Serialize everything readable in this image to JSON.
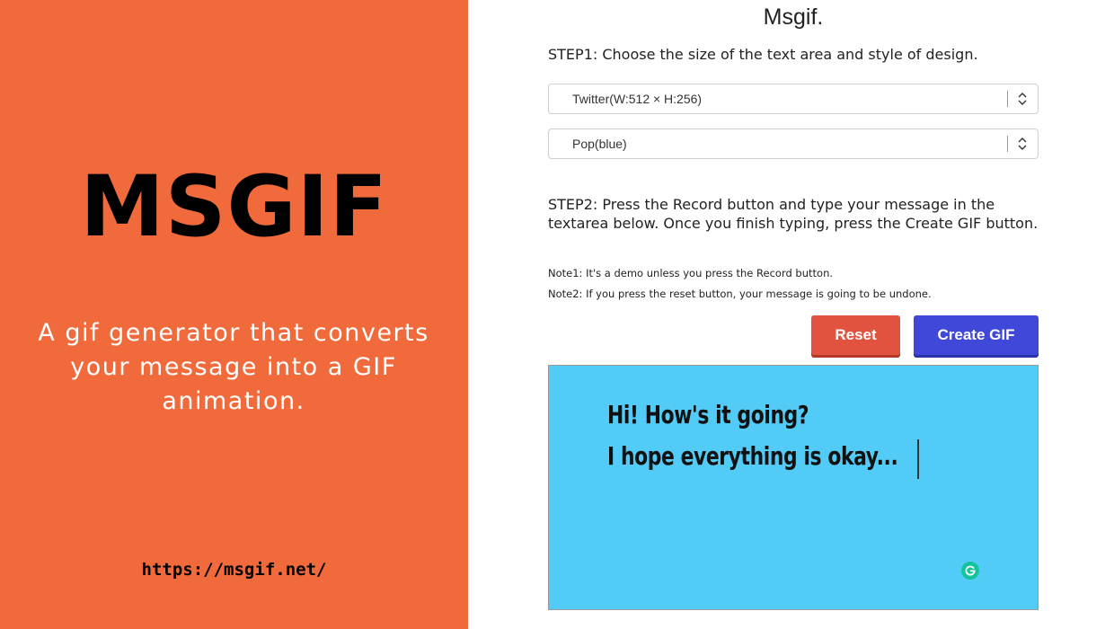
{
  "promo": {
    "title": "MSGIF",
    "tagline": "A gif generator that converts your message into a GIF animation.",
    "url": "https://msgif.net/",
    "background_color": "#F06A3B"
  },
  "app": {
    "logo": "Msgif.",
    "step1": "STEP1: Choose the size of the text area and style of design.",
    "size_select": {
      "value": "Twitter(W:512 × H:256)"
    },
    "style_select": {
      "value": "Pop(blue)"
    },
    "step2": "STEP2: Press the Record button and type your message in the textarea below. Once you finish typing, press the Create GIF button.",
    "note1": "Note1: It's a demo unless you press the Record button.",
    "note2": "Note2: If you press the reset button, your message is going to be undone.",
    "buttons": {
      "reset_label": "Reset",
      "create_label": "Create GIF",
      "reset_color": "#E2533F",
      "create_color": "#3F48D9"
    },
    "message": {
      "line1": "Hi! How's it going?",
      "line2": "I hope everything is okay...",
      "background_color": "#52CBF7"
    },
    "icons": {
      "select_indicator": "chevron-up-down-icon",
      "assistant": "grammarly-icon"
    }
  }
}
